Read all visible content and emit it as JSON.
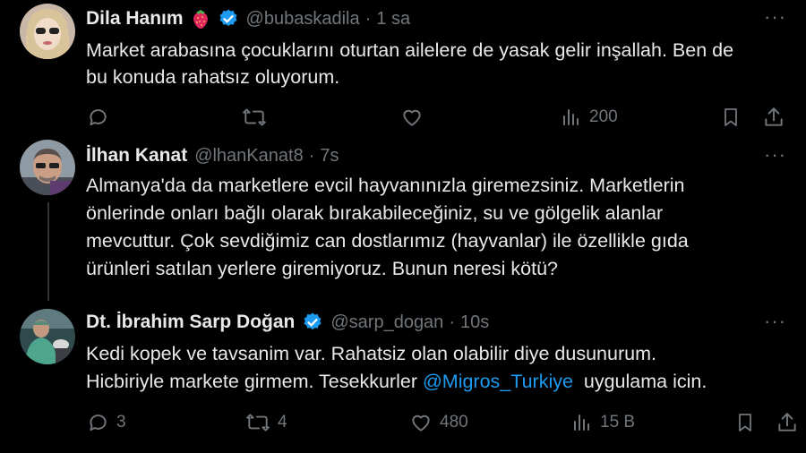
{
  "tweets": [
    {
      "name": "Dila Hanım",
      "handle": "@bubaskadila",
      "time": "1 sa",
      "text_lines": [
        "Market arabasına çocuklarını oturtan ailelere de yasak gelir inşallah. Ben de",
        "bu konuda rahatsız oluyorum."
      ],
      "views": "200",
      "emoji": "strawberry-icon",
      "verified": true
    },
    {
      "name": "İlhan Kanat",
      "handle": "@lhanKanat8",
      "time": "7s",
      "text_lines": [
        "Almanya'da da marketlere evcil hayvanınızla giremezsiniz. Marketlerin",
        "önlerinde onları bağlı olarak bırakabileceğiniz, su ve gölgelik alanlar",
        "mevcuttur. Çok sevdiğimiz can dostlarımız (hayvanlar) ile özellikle gıda",
        "ürünleri satılan yerlere giremiyoruz. Bunun neresi kötü?"
      ]
    },
    {
      "name": "Dt. İbrahim Sarp Doğan",
      "handle": "@sarp_dogan",
      "time": "10s",
      "text_line1": "Kedi kopek ve tavsanim var. Rahatsiz olan olabilir diye dusunurum.",
      "text_line2_before": "Hicbiriyle markete girmem. Tesekkurler ",
      "mention": "@Migros_Turkiye",
      "text_line2_after": "  uygulama icin.",
      "replies": "3",
      "retweets": "4",
      "likes": "480",
      "views": "15 B",
      "verified": true
    }
  ],
  "dot": "·",
  "more": "···",
  "colors": {
    "accent": "#1d9bf0",
    "muted": "#71767b",
    "text": "#e7e9ea",
    "background": "#000000"
  }
}
